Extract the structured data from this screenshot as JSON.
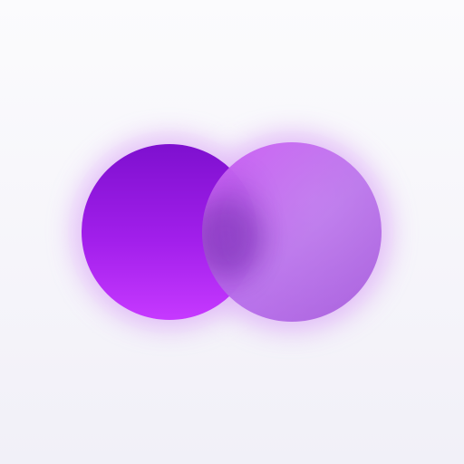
{
  "logo": {
    "name": "overlapping-circles-logo",
    "colors": {
      "background_top": "#fbfbfd",
      "background_bottom": "#f1f0f8",
      "glow": "#b86be6",
      "left_circle_top": "#7e10cf",
      "left_circle_bottom": "#c639ff",
      "right_circle_top": "#c759f2",
      "right_circle_bottom": "#a55fd9",
      "overlap_shadow": "#5d1a98"
    }
  }
}
